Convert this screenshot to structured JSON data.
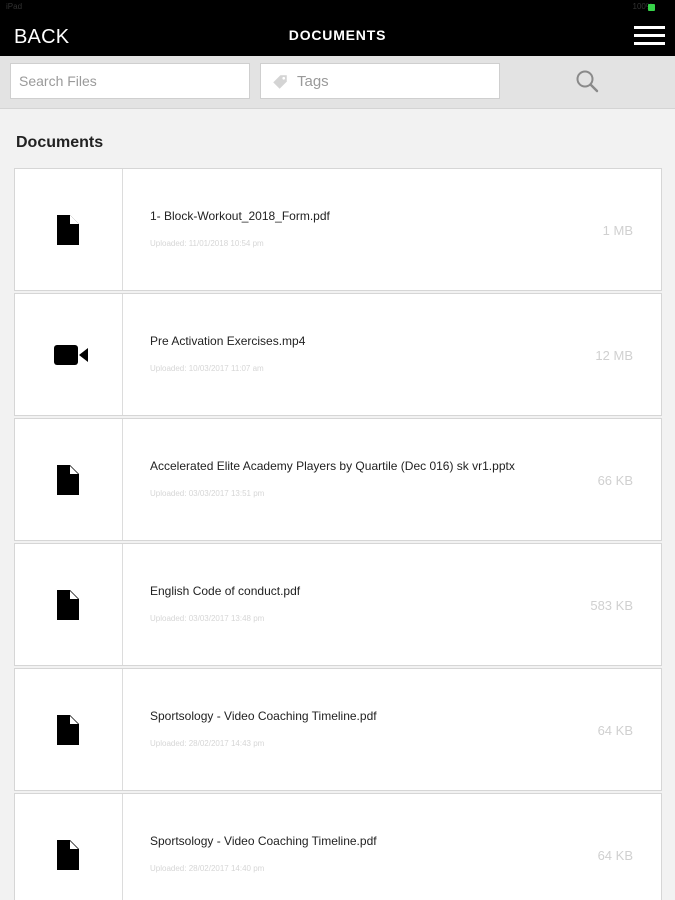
{
  "status_bar": {
    "left_text": "iPad",
    "right_text": "100%"
  },
  "nav": {
    "back_label": "BACK",
    "title": "DOCUMENTS",
    "menu_icon": "hamburger-menu-icon"
  },
  "search": {
    "files_placeholder": "Search Files",
    "files_value": "",
    "tags_placeholder": "Tags",
    "tags_value": "",
    "tag_icon": "tag-icon",
    "search_icon": "search-icon"
  },
  "section": {
    "title": "Documents"
  },
  "documents": [
    {
      "icon": "file-icon",
      "name": "1- Block-Workout_2018_Form.pdf",
      "uploaded": "Uploaded: 11/01/2018 10:54 pm",
      "size": "1 MB"
    },
    {
      "icon": "video-camera-icon",
      "name": "Pre Activation Exercises.mp4",
      "uploaded": "Uploaded: 10/03/2017 11:07 am",
      "size": "12 MB"
    },
    {
      "icon": "file-icon",
      "name": "Accelerated Elite Academy Players by Quartile (Dec 016) sk vr1.pptx",
      "uploaded": "Uploaded: 03/03/2017 13:51 pm",
      "size": "66 KB"
    },
    {
      "icon": "file-icon",
      "name": "English Code of conduct.pdf",
      "uploaded": "Uploaded: 03/03/2017 13:48 pm",
      "size": "583 KB"
    },
    {
      "icon": "file-icon",
      "name": "Sportsology - Video Coaching Timeline.pdf",
      "uploaded": "Uploaded: 28/02/2017 14:43 pm",
      "size": "64 KB"
    },
    {
      "icon": "file-icon",
      "name": "Sportsology - Video Coaching Timeline.pdf",
      "uploaded": "Uploaded: 28/02/2017 14:40 pm",
      "size": "64 KB"
    }
  ]
}
